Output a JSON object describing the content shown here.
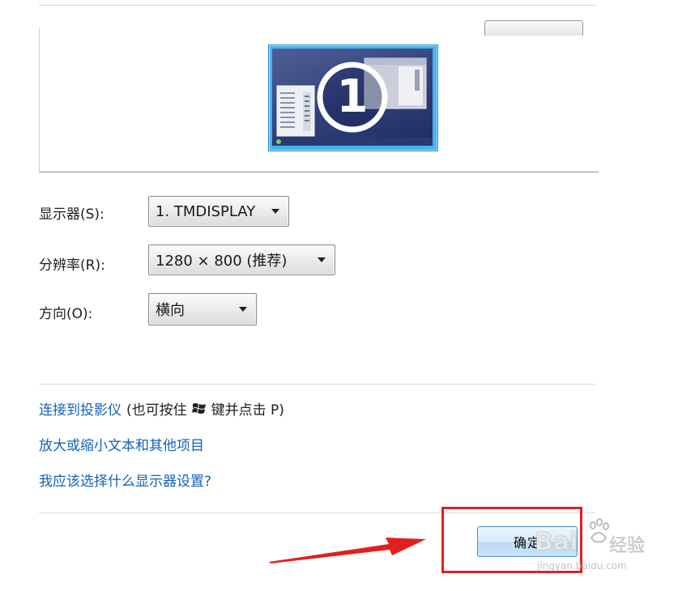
{
  "preview": {
    "monitor_number": "1"
  },
  "display_row": {
    "label": "显示器(S):",
    "value": "1. TMDISPLAY"
  },
  "resolution_row": {
    "label": "分辨率(R):",
    "value": "1280 × 800 (推荐)"
  },
  "orientation_row": {
    "label": "方向(O):",
    "value": "横向"
  },
  "links": {
    "projector": "连接到投影仪",
    "projector_note_prefix": "(也可按住",
    "projector_note_suffix": "键并点击 P)",
    "text_size": "放大或缩小文本和其他项目",
    "help": "我应该选择什么显示器设置?"
  },
  "ok_button": {
    "label": "确定"
  },
  "watermark": {
    "brand": "Bai",
    "cn": "经验",
    "url": "jingyan.baidu.com"
  },
  "colors": {
    "link": "#1462b8",
    "highlight": "#e21f1f",
    "arrow": "#e21f1f",
    "monitor_border": "#49b3ee"
  }
}
